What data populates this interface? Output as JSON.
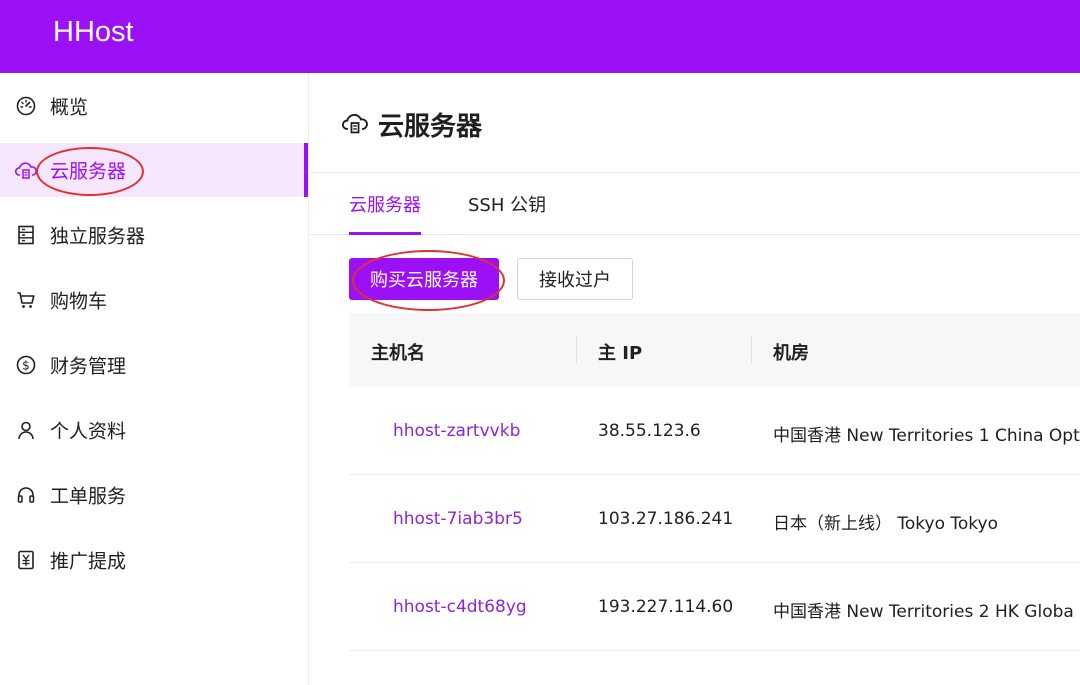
{
  "app": {
    "brand": "HHost"
  },
  "sidebar": {
    "items": [
      {
        "label": "概览",
        "icon": "dashboard-icon"
      },
      {
        "label": "云服务器",
        "icon": "cloud-server-icon",
        "active": true
      },
      {
        "label": "独立服务器",
        "icon": "server-icon"
      },
      {
        "label": "购物车",
        "icon": "cart-icon"
      },
      {
        "label": "财务管理",
        "icon": "dollar-icon"
      },
      {
        "label": "个人资料",
        "icon": "user-icon"
      },
      {
        "label": "工单服务",
        "icon": "headset-icon"
      },
      {
        "label": "推广提成",
        "icon": "commission-icon"
      }
    ]
  },
  "page": {
    "title": "云服务器",
    "icon": "cloud-server-icon",
    "tabs": [
      {
        "label": "云服务器",
        "active": true
      },
      {
        "label": "SSH 公钥"
      }
    ],
    "actions": {
      "buy_label": "购买云服务器",
      "receive_label": "接收过户"
    }
  },
  "table": {
    "columns": [
      "主机名",
      "主 IP",
      "机房"
    ],
    "rows": [
      {
        "hostname": "hhost-zartvvkb",
        "ip": "38.55.123.6",
        "location": "中国香港 New Territories 1 China Opt"
      },
      {
        "hostname": "hhost-7iab3br5",
        "ip": "103.27.186.241",
        "location": "日本（新上线） Tokyo Tokyo"
      },
      {
        "hostname": "hhost-c4dt68yg",
        "ip": "193.227.114.60",
        "location": "中国香港 New Territories 2 HK Globa"
      }
    ]
  },
  "colors": {
    "brand": "#9b10f5",
    "link": "#8e24d9",
    "annotation": "#e2302f"
  }
}
